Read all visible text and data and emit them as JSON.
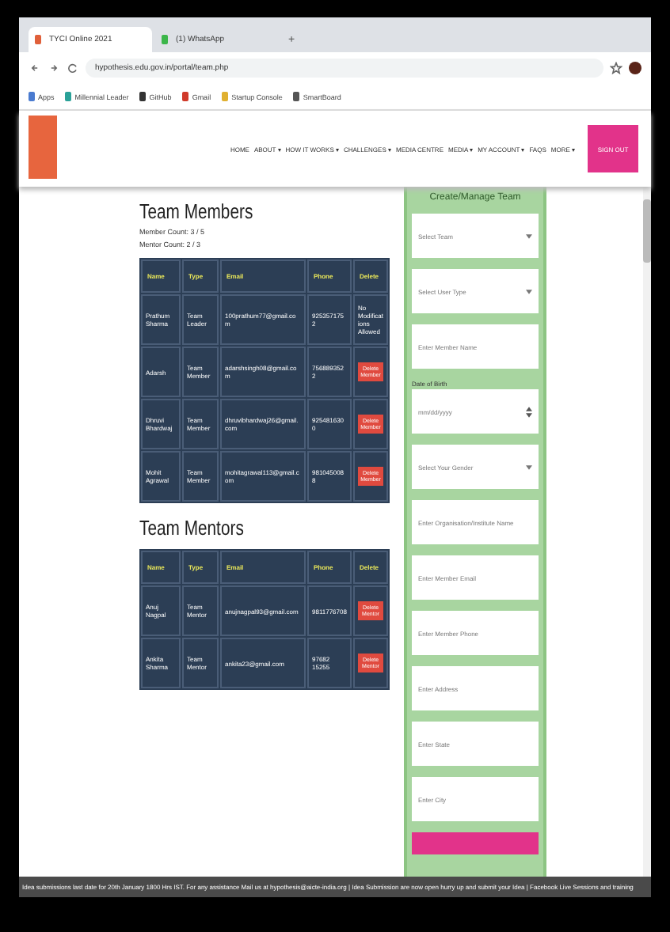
{
  "browser": {
    "tabs": [
      {
        "title": "TYCI Online 2021",
        "selected": true,
        "color": "#e0603a"
      },
      {
        "title": "(1) WhatsApp",
        "selected": false,
        "color": "#3cb64a"
      }
    ],
    "new_tab": "+",
    "url": "hypothesis.edu.gov.in/portal/team.php",
    "bookmarks": [
      {
        "label": "Apps",
        "color": "#4a7bd0"
      },
      {
        "label": "Millennial Leader",
        "color": "#2aa198"
      },
      {
        "label": "GitHub",
        "color": "#333333"
      },
      {
        "label": "Gmail",
        "color": "#d03a2a"
      },
      {
        "label": "Startup Console",
        "color": "#e0b030"
      },
      {
        "label": "SmartBoard",
        "color": "#555555"
      }
    ]
  },
  "header": {
    "nav": [
      "HOME",
      "ABOUT ▾",
      "HOW IT WORKS ▾",
      "CHALLENGES ▾",
      "MEDIA CENTRE",
      "MEDIA ▾",
      "MY ACCOUNT ▾",
      "FAQS",
      "MORE ▾"
    ],
    "button": "SIGN OUT"
  },
  "members": {
    "title": "Team Members",
    "counts": [
      "Member Count: 3 / 5",
      "Mentor Count: 2 / 3"
    ],
    "columns": [
      "Name",
      "Type",
      "Email",
      "Phone",
      "Delete"
    ],
    "rows": [
      {
        "name": "Prathum Sharma",
        "type": "Team Leader",
        "email": "100prathum77@gmail.com",
        "phone": "9253571752",
        "kind": "locked",
        "action": "No Modifications Allowed"
      },
      {
        "name": "Adarsh",
        "type": "Team Member",
        "email": "adarshsingh08@gmail.com",
        "phone": "7568893522",
        "kind": "delete",
        "action": "Delete Member"
      },
      {
        "name": "Dhruvi Bhardwaj",
        "type": "Team Member",
        "email": "dhruvibhardwaj26@gmail.com",
        "phone": "9254816300",
        "kind": "delete",
        "action": "Delete Member"
      },
      {
        "name": "Mohit Agrawal",
        "type": "Team Member",
        "email": "mohitagrawal113@gmail.com",
        "phone": "9810450088",
        "kind": "delete",
        "action": "Delete Member"
      }
    ]
  },
  "mentors": {
    "title": "Team Mentors",
    "columns": [
      "Name",
      "Type",
      "Email",
      "Phone",
      "Delete"
    ],
    "rows": [
      {
        "name": "Anuj Nagpal",
        "type": "Team Mentor",
        "email": "anujnagpal93@gmail.com",
        "phone": "9811776708",
        "kind": "delete",
        "action": "Delete Mentor"
      },
      {
        "name": "Ankita Sharma",
        "type": "Team Mentor",
        "email": "ankita23@gmail.com",
        "phone": "97682 15255",
        "kind": "delete",
        "action": "Delete Mentor"
      }
    ]
  },
  "form": {
    "title": "Create/Manage Team",
    "fields": [
      {
        "kind": "select",
        "placeholder": "Select Team"
      },
      {
        "kind": "select",
        "placeholder": "Select User Type"
      },
      {
        "kind": "text",
        "placeholder": "Enter Member Name"
      },
      {
        "kind": "date",
        "label": "Date of Birth",
        "placeholder": "mm/dd/yyyy"
      },
      {
        "kind": "select",
        "placeholder": "Select Your Gender"
      },
      {
        "kind": "text",
        "placeholder": "Enter Organisation/Institute Name"
      },
      {
        "kind": "text",
        "placeholder": "Enter Member Email"
      },
      {
        "kind": "text",
        "placeholder": "Enter Member Phone"
      },
      {
        "kind": "text",
        "placeholder": "Enter Address"
      },
      {
        "kind": "text",
        "placeholder": "Enter State"
      },
      {
        "kind": "text",
        "placeholder": "Enter City"
      }
    ]
  },
  "ticker": "Idea submissions last date for 20th January 1800 Hrs IST.     For any assistance Mail us at hypothesis@aicte-india.org | Idea Submission are now open hurry up and submit your Idea | Facebook Live Sessions and training"
}
